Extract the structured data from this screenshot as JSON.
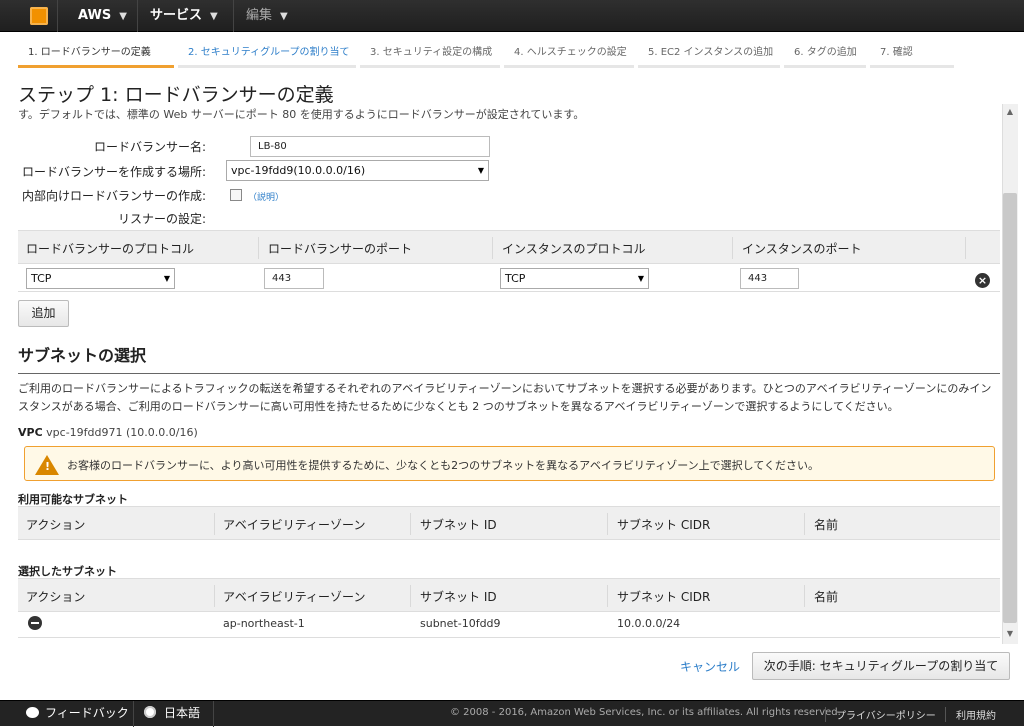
{
  "topbar": {
    "aws": "AWS",
    "services": "サービス",
    "edit": "編集"
  },
  "steps": [
    "1. ロードバランサーの定義",
    "2. セキュリティグループの割り当て",
    "3. セキュリティ設定の構成",
    "4. ヘルスチェックの設定",
    "5. EC2 インスタンスの追加",
    "6. タグの追加",
    "7. 確認"
  ],
  "page": {
    "title": "ステップ 1: ロードバランサーの定義",
    "description": "す。デフォルトでは、標準の Web サーバーにポート 80 を使用するようにロードバランサーが設定されています。"
  },
  "form": {
    "name_label": "ロードバランサー名:",
    "name_value": "LB-80",
    "location_label": "ロードバランサーを作成する場所:",
    "location_value": "vpc-19fdd9(10.0.0.0/16)",
    "internal_label": "内部向けロードバランサーの作成:",
    "internal_link": "（説明）",
    "listener_label": "リスナーの設定:"
  },
  "listeners": {
    "headers": [
      "ロードバランサーのプロトコル",
      "ロードバランサーのポート",
      "インスタンスのプロトコル",
      "インスタンスのポート"
    ],
    "row": {
      "lb_protocol": "TCP",
      "lb_port": "443",
      "instance_protocol": "TCP",
      "instance_port": "443"
    },
    "add_button": "追加"
  },
  "subnets": {
    "title": "サブネットの選択",
    "description": "ご利用のロードバランサーによるトラフィックの転送を希望するそれぞれのアベイラビリティーゾーンにおいてサブネットを選択する必要があります。ひとつのアベイラビリティーゾーンにのみインスタンスがある場合、ご利用のロードバランサーに高い可用性を持たせるために少なくとも 2 つのサブネットを異なるアベイラビリティーゾーンで選択するようにしてください。",
    "vpc_label": "VPC",
    "vpc_value": "vpc-19fdd971 (10.0.0.0/16)",
    "warning": "お客様のロードバランサーに、より高い可用性を提供するために、少なくとも2つのサブネットを異なるアベイラビリティゾーン上で選択してください。",
    "available_label": "利用可能なサブネット",
    "selected_label": "選択したサブネット",
    "columns": [
      "アクション",
      "アベイラビリティーゾーン",
      "サブネット ID",
      "サブネット CIDR",
      "名前"
    ],
    "selected_row": {
      "az": "ap-northeast-1",
      "subnet_id": "subnet-10fdd9",
      "cidr": "10.0.0.0/24",
      "name": ""
    }
  },
  "actions": {
    "cancel": "キャンセル",
    "next": "次の手順: セキュリティグループの割り当て"
  },
  "footer": {
    "feedback": "フィードバック",
    "language": "日本語",
    "copyright": "© 2008 - 2016, Amazon Web Services, Inc. or its affiliates. All rights reserved.",
    "privacy": "プライバシーポリシー",
    "terms": "利用規約"
  },
  "colors": {
    "accent": "#f0a030",
    "link": "#2d7ec9",
    "topbar": "#232323"
  }
}
